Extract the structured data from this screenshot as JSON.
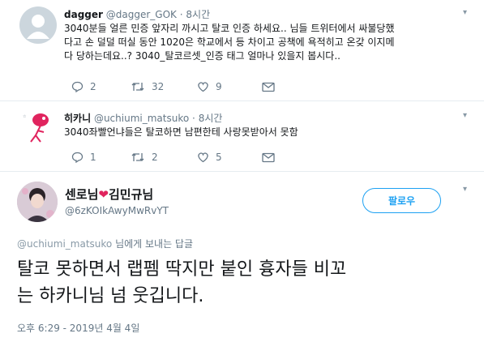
{
  "tweets": [
    {
      "name": "dagger",
      "handle": "@dagger_GOK",
      "separator": "·",
      "time": "8시간",
      "text_lines": [
        "3040분들 얼른 민증 앞자리 까시고 탈코 인증 하세요.. 님들 트위터에서 싸불당했",
        "다고 손 덜덜 떠실 동안 1020은 학교에서 등 차이고 공책에 욕적히고 온갖 이지메",
        "다 당하는데요..? 3040_탈코르셋_인증 태그 얼마나 있을지 봅시다.."
      ],
      "reply_count": "2",
      "retweet_count": "32",
      "like_count": "9",
      "avatar_icon": "default-profile-icon"
    },
    {
      "name": "히카니",
      "handle": "@uchiumi_matsuko",
      "separator": "·",
      "time": "8시간",
      "text_lines": [
        "3040좌빨언냐들은 탈코하면 남편한테 사랑못받아서 못함"
      ],
      "reply_count": "1",
      "retweet_count": "2",
      "like_count": "5",
      "avatar_icon": "red-character-icon"
    }
  ],
  "main_tweet": {
    "name_part1": "센로님",
    "heart": "❤",
    "name_part2": "김민규님",
    "handle": "@6zKOIkAwyMwRvYT",
    "follow_label": "팔로우",
    "reply_to_link": "@uchiumi_matsuko",
    "reply_to_suffix": " 님에게 보내는 답글",
    "text_lines": [
      "탈코 못하면서 랩펨 딱지만 붙인 흉자들 비꼬",
      "는 하카니님 넘 웃깁니다."
    ],
    "timestamp": "오후 6:29 - 2019년 4월 4일"
  },
  "colors": {
    "accent": "#1da1f2",
    "muted": "#657786",
    "heart": "#e0245e",
    "divider": "#e6ecf0"
  }
}
